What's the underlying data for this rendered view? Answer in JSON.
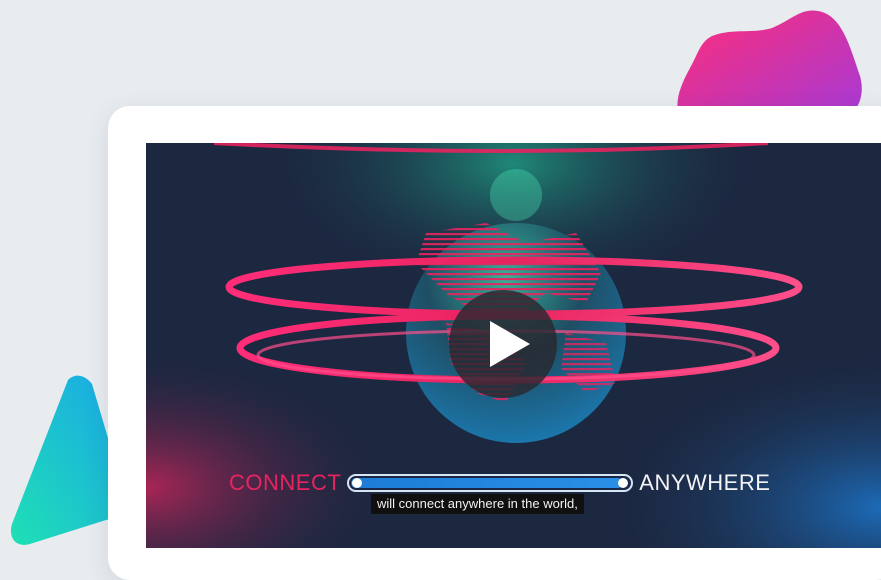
{
  "decorations": {
    "blob_color_start": "#ff2d78",
    "blob_color_end": "#a43ad8",
    "triangle_color_start": "#1fe0b4",
    "triangle_color_end": "#1aa6e8"
  },
  "video": {
    "play_icon": "play-icon",
    "tagline_left": "CONNECT",
    "tagline_right": "ANYWHERE",
    "caption": "will connect anywhere in the world,",
    "progress_fraction": 0.97,
    "accent_pink": "#e7245f",
    "accent_blue": "#1c7cd6"
  }
}
